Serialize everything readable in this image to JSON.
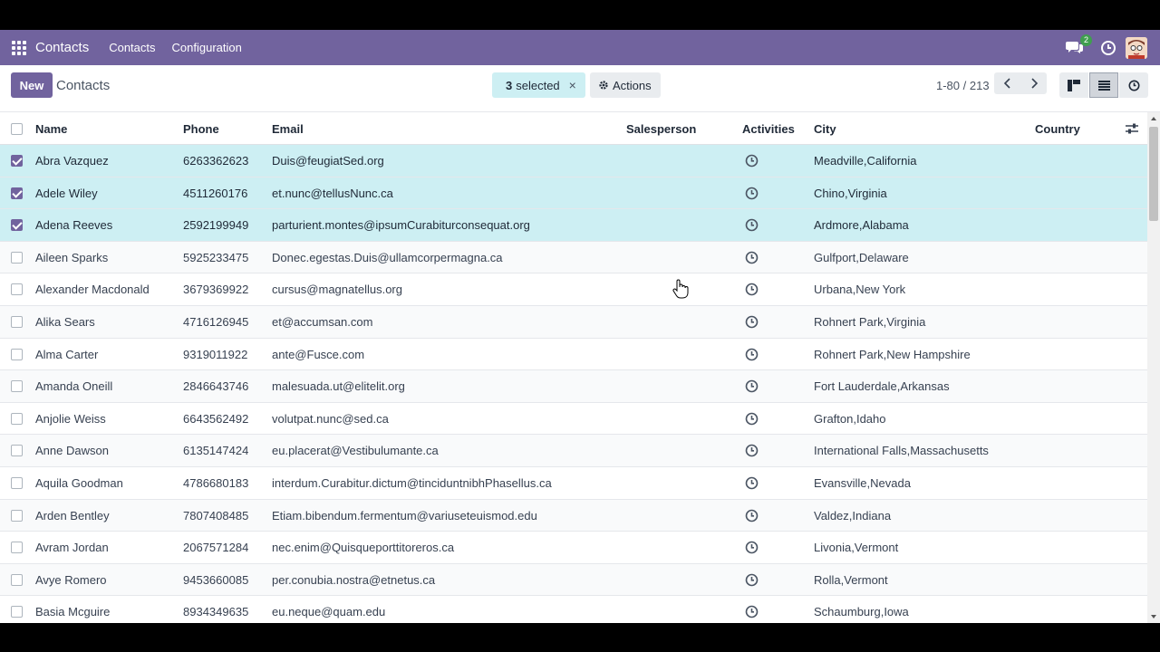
{
  "navbar": {
    "app_name": "Contacts",
    "menus": [
      "Contacts",
      "Configuration"
    ],
    "chat_badge": "2",
    "bg_color": "#71639e"
  },
  "control": {
    "new_label": "New",
    "breadcrumb": "Contacts",
    "selected_count": "3",
    "selected_label": "selected",
    "close_glyph": "×",
    "actions_label": "Actions",
    "pager_text": "1-80 / 213"
  },
  "columns": {
    "name": "Name",
    "phone": "Phone",
    "email": "Email",
    "salesperson": "Salesperson",
    "activities": "Activities",
    "city": "City",
    "country": "Country"
  },
  "rows": [
    {
      "name": "Abra Vazquez",
      "phone": "6263362623",
      "email": "Duis@feugiatSed.org",
      "salesperson": "",
      "city": "Meadville,California",
      "country": "",
      "selected": true
    },
    {
      "name": "Adele Wiley",
      "phone": "4511260176",
      "email": "et.nunc@tellusNunc.ca",
      "salesperson": "",
      "city": "Chino,Virginia",
      "country": "",
      "selected": true
    },
    {
      "name": "Adena Reeves",
      "phone": "2592199949",
      "email": "parturient.montes@ipsumCurabiturconsequat.org",
      "salesperson": "",
      "city": "Ardmore,Alabama",
      "country": "",
      "selected": true
    },
    {
      "name": "Aileen Sparks",
      "phone": "5925233475",
      "email": "Donec.egestas.Duis@ullamcorpermagna.ca",
      "salesperson": "",
      "city": "Gulfport,Delaware",
      "country": "",
      "selected": false
    },
    {
      "name": "Alexander Macdonald",
      "phone": "3679369922",
      "email": "cursus@magnatellus.org",
      "salesperson": "",
      "city": "Urbana,New York",
      "country": "",
      "selected": false
    },
    {
      "name": "Alika Sears",
      "phone": "4716126945",
      "email": "et@accumsan.com",
      "salesperson": "",
      "city": "Rohnert Park,Virginia",
      "country": "",
      "selected": false
    },
    {
      "name": "Alma Carter",
      "phone": "9319011922",
      "email": "ante@Fusce.com",
      "salesperson": "",
      "city": "Rohnert Park,New Hampshire",
      "country": "",
      "selected": false
    },
    {
      "name": "Amanda Oneill",
      "phone": "2846643746",
      "email": "malesuada.ut@elitelit.org",
      "salesperson": "",
      "city": "Fort Lauderdale,Arkansas",
      "country": "",
      "selected": false
    },
    {
      "name": "Anjolie Weiss",
      "phone": "6643562492",
      "email": "volutpat.nunc@sed.ca",
      "salesperson": "",
      "city": "Grafton,Idaho",
      "country": "",
      "selected": false
    },
    {
      "name": "Anne Dawson",
      "phone": "6135147424",
      "email": "eu.placerat@Vestibulumante.ca",
      "salesperson": "",
      "city": "International Falls,Massachusetts",
      "country": "",
      "selected": false
    },
    {
      "name": "Aquila Goodman",
      "phone": "4786680183",
      "email": "interdum.Curabitur.dictum@tinciduntnibhPhasellus.ca",
      "salesperson": "",
      "city": "Evansville,Nevada",
      "country": "",
      "selected": false
    },
    {
      "name": "Arden Bentley",
      "phone": "7807408485",
      "email": "Etiam.bibendum.fermentum@variuseteuismod.edu",
      "salesperson": "",
      "city": "Valdez,Indiana",
      "country": "",
      "selected": false
    },
    {
      "name": "Avram Jordan",
      "phone": "2067571284",
      "email": "nec.enim@Quisqueporttitoreros.ca",
      "salesperson": "",
      "city": "Livonia,Vermont",
      "country": "",
      "selected": false
    },
    {
      "name": "Avye Romero",
      "phone": "9453660085",
      "email": "per.conubia.nostra@etnetus.ca",
      "salesperson": "",
      "city": "Rolla,Vermont",
      "country": "",
      "selected": false
    },
    {
      "name": "Basia Mcguire",
      "phone": "8934349635",
      "email": "eu.neque@quam.edu",
      "salesperson": "",
      "city": "Schaumburg,Iowa",
      "country": "",
      "selected": false
    }
  ],
  "colors": {
    "selected_row": "#cdeff3",
    "accent": "#71639e"
  }
}
